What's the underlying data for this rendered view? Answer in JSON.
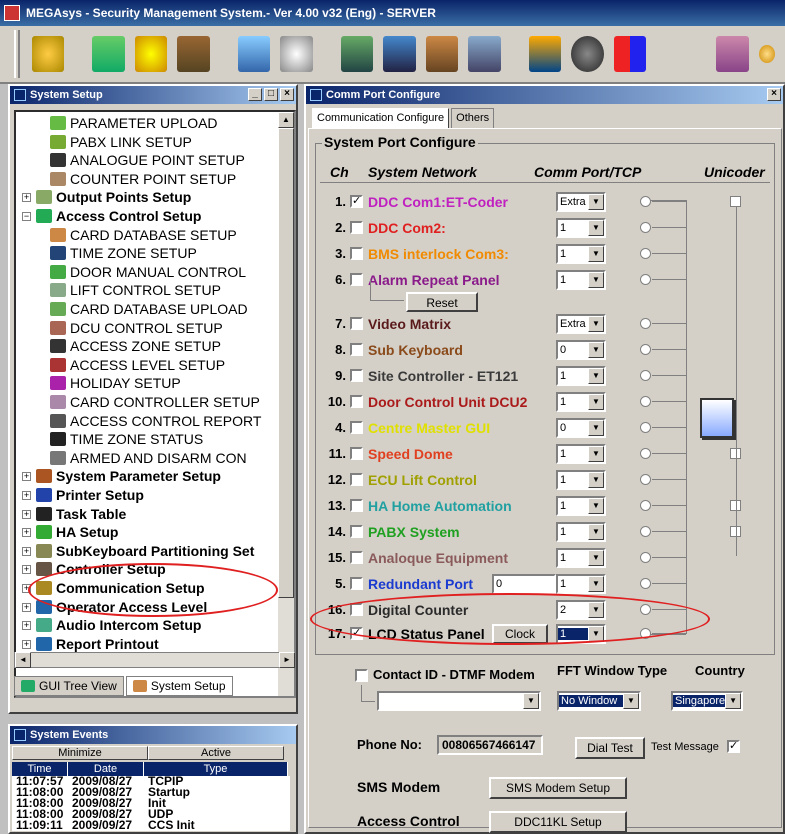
{
  "app": {
    "title": "MEGAsys  - Security Management System.- Ver 4.00 v32  (Eng)  - SERVER"
  },
  "toolbar": {
    "icons": [
      "padlock-icon",
      "network-icon",
      "safety-icon",
      "cards-icon",
      "connect-icon",
      "clock-icon",
      "report-icon",
      "doc-icon",
      "people-icon",
      "tools-icon",
      "monitor-icon",
      "globe-icon",
      "palette-icon",
      "grid-icon",
      "bulb-icon"
    ]
  },
  "system_setup": {
    "title": "System Setup",
    "items": [
      {
        "label": "PARAMETER UPLOAD",
        "level": "sub",
        "icon": "#6b4",
        "top": true
      },
      {
        "label": "PABX LINK SETUP",
        "level": "sub",
        "icon": "#7a3"
      },
      {
        "label": "ANALOGUE POINT SETUP",
        "level": "sub",
        "icon": "#333"
      },
      {
        "label": "COUNTER POINT SETUP",
        "level": "sub",
        "icon": "#a86"
      },
      {
        "label": "Output Points Setup",
        "level": "top",
        "icon": "#8a6"
      },
      {
        "label": "Access Control Setup",
        "level": "top",
        "icon": "#2a5"
      },
      {
        "label": "CARD DATABASE SETUP",
        "level": "sub",
        "icon": "#c84"
      },
      {
        "label": "TIME ZONE SETUP",
        "level": "sub",
        "icon": "#247"
      },
      {
        "label": "DOOR MANUAL CONTROL",
        "level": "sub",
        "icon": "#4a4"
      },
      {
        "label": "LIFT CONTROL SETUP",
        "level": "sub",
        "icon": "#8a8"
      },
      {
        "label": "CARD DATABASE UPLOAD",
        "level": "sub",
        "icon": "#6a5"
      },
      {
        "label": "DCU CONTROL SETUP",
        "level": "sub",
        "icon": "#a65"
      },
      {
        "label": "ACCESS ZONE SETUP",
        "level": "sub",
        "icon": "#333"
      },
      {
        "label": "ACCESS LEVEL SETUP",
        "level": "sub",
        "icon": "#a33"
      },
      {
        "label": "HOLIDAY SETUP",
        "level": "sub",
        "icon": "#a2a"
      },
      {
        "label": "CARD CONTROLLER SETUP",
        "level": "sub",
        "icon": "#a8a"
      },
      {
        "label": "ACCESS CONTROL REPORT",
        "level": "sub",
        "icon": "#555"
      },
      {
        "label": "TIME ZONE STATUS",
        "level": "sub",
        "icon": "#222"
      },
      {
        "label": "ARMED AND DISARM CON",
        "level": "sub",
        "icon": "#777"
      },
      {
        "label": "System Parameter Setup",
        "level": "top",
        "icon": "#a52"
      },
      {
        "label": "Printer Setup",
        "level": "top",
        "icon": "#24a"
      },
      {
        "label": "Task Table",
        "level": "top",
        "icon": "#222"
      },
      {
        "label": "HA Setup",
        "level": "top",
        "icon": "#3a3"
      },
      {
        "label": "SubKeyboard Partitioning Set",
        "level": "top",
        "icon": "#885"
      },
      {
        "label": "Controller Setup",
        "level": "top",
        "icon": "#654"
      },
      {
        "label": "Communication Setup",
        "level": "top",
        "icon": "#a82"
      },
      {
        "label": "Operator Access Level",
        "level": "top",
        "icon": "#26a"
      },
      {
        "label": "Audio Intercom Setup",
        "level": "top",
        "icon": "#4a8"
      },
      {
        "label": "Report Printout",
        "level": "top",
        "icon": "#26a"
      }
    ],
    "tabs": [
      "GUI Tree View",
      "System Setup"
    ]
  },
  "events": {
    "title": "System Events",
    "buttons": [
      "Minimize",
      "Active"
    ],
    "columns": [
      "Time",
      "Date",
      "Type"
    ],
    "rows": [
      [
        "11:07:57",
        "2009/08/27",
        "TCPIP"
      ],
      [
        "11:08:00",
        "2009/08/27",
        "Startup"
      ],
      [
        "11:08:00",
        "2009/08/27",
        "Init"
      ],
      [
        "11:08:00",
        "2009/08/27",
        "UDP"
      ],
      [
        "11:09:11",
        "2009/09/27",
        "CCS Init"
      ]
    ]
  },
  "comm": {
    "title": "Comm Port Configure",
    "tabs": [
      "Communication Configure",
      "Others"
    ],
    "group_title": "System Port Configure",
    "headers": {
      "ch": "Ch",
      "network": "System Network",
      "port": "Comm Port/TCP",
      "unicoder": "Unicoder"
    },
    "rows": [
      {
        "num": "1.",
        "checked": true,
        "label": "DDC Com1:ET-Coder",
        "color": "#c020c0",
        "value": "Extra",
        "unicoder": true
      },
      {
        "num": "2.",
        "checked": false,
        "label": "DDC Com2:",
        "color": "#e02020",
        "value": "1",
        "unicoder": false
      },
      {
        "num": "3.",
        "checked": false,
        "label": "BMS interlock Com3:",
        "color": "#f08a00",
        "value": "1",
        "unicoder": false
      },
      {
        "num": "6.",
        "checked": false,
        "label": "Alarm Repeat Panel",
        "color": "#8a1a8a",
        "value": "1",
        "unicoder": false
      },
      {
        "num": "7.",
        "checked": false,
        "label": "Video Matrix",
        "color": "#5a1a1a",
        "value": "Extra",
        "unicoder": false
      },
      {
        "num": "8.",
        "checked": false,
        "label": "Sub Keyboard",
        "color": "#8a4a1a",
        "value": "0",
        "unicoder": false
      },
      {
        "num": "9.",
        "checked": false,
        "label": "Site Controller - ET121",
        "color": "#3a3a3a",
        "value": "1",
        "unicoder": false
      },
      {
        "num": "10.",
        "checked": false,
        "label": "Door Control Unit DCU2",
        "color": "#aa1a1a",
        "value": "1",
        "unicoder": false
      },
      {
        "num": "4.",
        "checked": false,
        "label": "Centre Master GUI",
        "color": "#e0e000",
        "value": "0",
        "unicoder": false
      },
      {
        "num": "11.",
        "checked": false,
        "label": "Speed Dome",
        "color": "#e04020",
        "value": "1",
        "unicoder": true
      },
      {
        "num": "12.",
        "checked": false,
        "label": "ECU Lift Control",
        "color": "#a0a000",
        "value": "1",
        "unicoder": false
      },
      {
        "num": "13.",
        "checked": false,
        "label": "HA Home Automation",
        "color": "#20a0a0",
        "value": "1",
        "unicoder": true
      },
      {
        "num": "14.",
        "checked": false,
        "label": "PABX System",
        "color": "#20a020",
        "value": "1",
        "unicoder": true
      },
      {
        "num": "15.",
        "checked": false,
        "label": "Analoque Equipment",
        "color": "#8a5a5a",
        "value": "1",
        "unicoder": false
      },
      {
        "num": "5.",
        "checked": false,
        "label": "Redundant Port",
        "color": "#1a3ad0",
        "value": "1",
        "unicoder": false,
        "extra": "0"
      },
      {
        "num": "16.",
        "checked": false,
        "label": "Digital Counter",
        "color": "#2a2a2a",
        "value": "2",
        "unicoder": false
      },
      {
        "num": "17.",
        "checked": true,
        "label": "LCD Status Panel",
        "color": "#000000",
        "value": "1",
        "unicoder": false
      }
    ],
    "reset_label": "Reset",
    "clock_label": "Clock",
    "contact": {
      "label": "Contact ID - DTMF Modem",
      "fft_label": "FFT Window Type",
      "country_label": "Country",
      "fft_value": "No Window",
      "country_value": "Singapore"
    },
    "phone": {
      "label": "Phone No:",
      "value": "00806567466147",
      "dial_label": "Dial Test",
      "test_label": "Test Message"
    },
    "sms": {
      "label": "SMS Modem",
      "button": "SMS Modem Setup"
    },
    "access": {
      "label": "Access Control",
      "button": "DDC11KL Setup"
    }
  }
}
